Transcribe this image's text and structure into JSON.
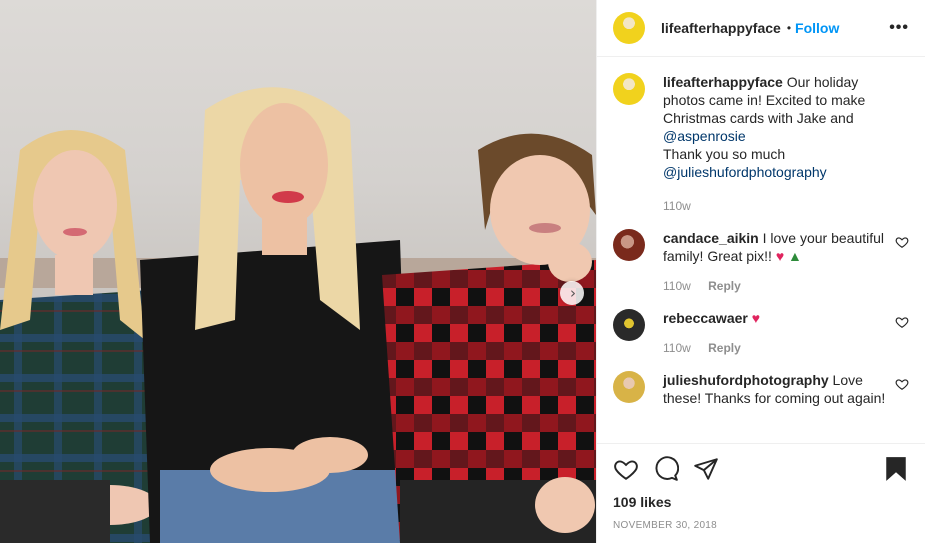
{
  "header": {
    "username": "lifeafterhappyface",
    "separator": "•",
    "follow_label": "Follow",
    "more_label": "•••"
  },
  "caption": {
    "username": "lifeafterhappyface",
    "text_1": "Our holiday photos came in! Excited to make Christmas cards with Jake and",
    "mention_1": "@aspenrosie",
    "text_2": "Thank you so much",
    "mention_2": "@julieshufordphotography",
    "time": "110w"
  },
  "comments": [
    {
      "username": "candace_aikin",
      "text": "I love your beautiful family! Great pix!!",
      "emoji": [
        "heart",
        "tree"
      ],
      "time": "110w",
      "reply_label": "Reply"
    },
    {
      "username": "rebeccawaer",
      "text": "",
      "emoji": [
        "heart"
      ],
      "time": "110w",
      "reply_label": "Reply"
    },
    {
      "username": "julieshufordphotography",
      "text": "Love these! Thanks for coming out again!",
      "emoji": [],
      "time": "",
      "reply_label": ""
    }
  ],
  "emoji_glyphs": {
    "heart": "♥",
    "tree": "▲"
  },
  "actions": {
    "icons": [
      "heart-icon",
      "comment-icon",
      "share-icon",
      "bookmark-icon"
    ],
    "likes": "109 likes",
    "date": "NOVEMBER 30, 2018"
  },
  "photo": {
    "next_glyph": "›"
  },
  "colors": {
    "accent": "#0095f6",
    "mention": "#00376b",
    "muted": "#8e8e8e",
    "heart": "#e0245e"
  }
}
